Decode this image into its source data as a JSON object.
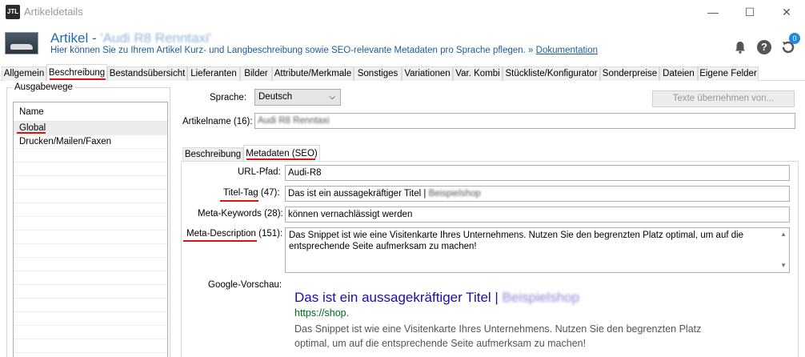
{
  "window": {
    "app_icon_text": "JTL",
    "title": "Artikeldetails",
    "minimize": "—",
    "maximize": "☐",
    "close": "✕"
  },
  "header": {
    "title_prefix": "Artikel - ",
    "title_blurred": "'Audi R8 Renntaxi'",
    "subtitle": "Hier können Sie zu Ihrem Artikel Kurz- und Langbeschreibung sowie SEO-relevante Metadaten pro Sprache pflegen. »",
    "doc_link": "Dokumentation",
    "help_icon_text": "?",
    "badge_count": "0"
  },
  "tabs": [
    "Allgemein",
    "Beschreibung",
    "Bestandsübersicht",
    "Lieferanten",
    "Bilder",
    "Attribute/Merkmale",
    "Sonstiges",
    "Variationen",
    "Var. Kombi",
    "Stückliste/Konfigurator",
    "Sonderpreise",
    "Dateien",
    "Eigene Felder"
  ],
  "active_tab": "Beschreibung",
  "ausgabewege": {
    "label": "Ausgabewege",
    "column_header": "Name",
    "rows": [
      "Global",
      "Drucken/Mailen/Faxen"
    ]
  },
  "form": {
    "sprache_label": "Sprache:",
    "sprache_value": "Deutsch",
    "texte_button": "Texte übernehmen von...",
    "artikelname_label": "Artikelname (16):",
    "artikelname_value": "Audi R8 Renntaxi"
  },
  "subtabs": [
    "Beschreibung",
    "Metadaten (SEO)"
  ],
  "seo": {
    "url_label": "URL-Pfad:",
    "url_value": "Audi-R8",
    "titel_label": "Titel-Tag (47):",
    "titel_value": "Das ist ein aussagekräftiger Titel | ",
    "titel_blurred": "Beispielshop",
    "keywords_label": "Meta-Keywords (28):",
    "keywords_value": "können vernachlässigt werden",
    "description_label": "Meta-Description (151):",
    "description_value": "Das Snippet ist wie eine Visitenkarte Ihres Unternehmens. Nutzen Sie den begrenzten Platz optimal, um auf die entsprechende Seite aufmerksam zu machen!",
    "preview_label": "Google-Vorschau:"
  },
  "preview": {
    "title": "Das ist ein aussagekräftiger Titel | ",
    "title_blurred": "Beispielshop",
    "url": "https://shop.",
    "description": "Das Snippet ist wie eine Visitenkarte Ihres Unternehmens. Nutzen Sie den begrenzten Platz optimal, um auf die entsprechende Seite aufmerksam zu machen!"
  },
  "colors": {
    "accent_blue": "#1e6ab0",
    "annotation_red": "#dd1111",
    "preview_link": "#1a0dab",
    "preview_url": "#006621"
  }
}
